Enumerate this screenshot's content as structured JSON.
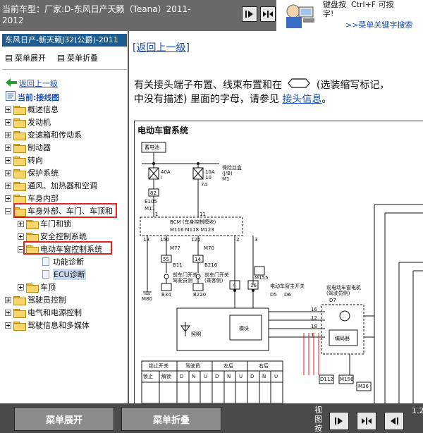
{
  "header": {
    "title": "当前车型：厂家:D-东风日产天籁（Teana）2011-2012",
    "hint_text": "键盘按  Ctrl+F 可按\n字!",
    "hint_link": ">>菜单关键字搜索"
  },
  "sidebar": {
    "car_name": "东风日产-新天籁J32(公爵)-2011",
    "expand_label": "菜单展开",
    "collapse_label": "菜单折叠",
    "back_label": "返回上一级",
    "current_label": "当前:接线图",
    "tree": {
      "item0": "概述信息",
      "item1": "发动机",
      "item2": "变速箱和传动系",
      "item3": "制动器",
      "item4": "转向",
      "item5": "保护系统",
      "item6": "通风、加热器和空调",
      "item7": "车身内部",
      "item8": "车身外部、车门、车顶和",
      "item9": "车门和锁",
      "item10": "安全控制系统",
      "item11": "电动车窗控制系统",
      "item12": "功能诊断",
      "item13": "ECU诊断",
      "item14": "车顶",
      "item15": "驾驶员控制",
      "item16": "电气和电源控制",
      "item17": "驾驶信息和多媒体"
    }
  },
  "content": {
    "back_link": "[返回上一级]",
    "para_line1_a": "有关接头端子布置、线束布置和在",
    "para_line1_b": "(选装缩写标记，",
    "para_line2_a": "中没有描述) 里面的字母，请参见",
    "para_link": "接头信息",
    "para_end": "。",
    "diagram": {
      "title": "电动车窗系统",
      "labels": {
        "battery": "蓄电池",
        "fuse40": "40A",
        "fuse40n": "i",
        "fuse10": "10A",
        "fuse10n": "10",
        "fuseblock": "保险丝盒",
        "jb": "(J/B)",
        "m1": "M1",
        "n82": "82",
        "n7a": "7A",
        "e105": "E105",
        "m11": "M11",
        "n11a": "1",
        "n11b": "11",
        "bcm": "BCM (车身控制模块)",
        "bcm_conn": "M116  M118  M123",
        "p13": "13",
        "p150": "150",
        "p124": "124",
        "p2": "2",
        "p3": "3",
        "m77": "M77",
        "m70": "M70",
        "b11": "B11",
        "b216": "B216",
        "p55": "55",
        "p14": "14",
        "ds1": "前车门开关",
        "ds1b": "驾驶员侧",
        "ds2": "前车门开关",
        "ds2b": "(乘客侧)",
        "b34": "B34",
        "b220": "B220",
        "m80": "M80",
        "m155": "M155",
        "d5": "D5",
        "d6": "D6",
        "p4": "4",
        "p16": "16",
        "mainsw": "电动车窗主开关",
        "motor": "前电动车窗电机",
        "motorb": "(驾驶员侧)",
        "d7": "D7",
        "n16": "16",
        "n12": "12",
        "n18": "18",
        "n1": "1",
        "lighting": "照明",
        "module": "模块",
        "encoder": "编码器",
        "lock": "锁止开关",
        "lockon": "锁止",
        "unlock": "解锁",
        "tbl_d": "驾驶员",
        "tbl_l": "左后",
        "tbl_r": "右后",
        "D": "D",
        "N": "N",
        "U": "U",
        "d112": "D112",
        "m156": "M156",
        "m36": "M36"
      }
    }
  },
  "footer": {
    "expand_label": "菜单展开",
    "collapse_label": "菜单折叠",
    "view_label": "视图按",
    "zoom_label": "1.2"
  }
}
